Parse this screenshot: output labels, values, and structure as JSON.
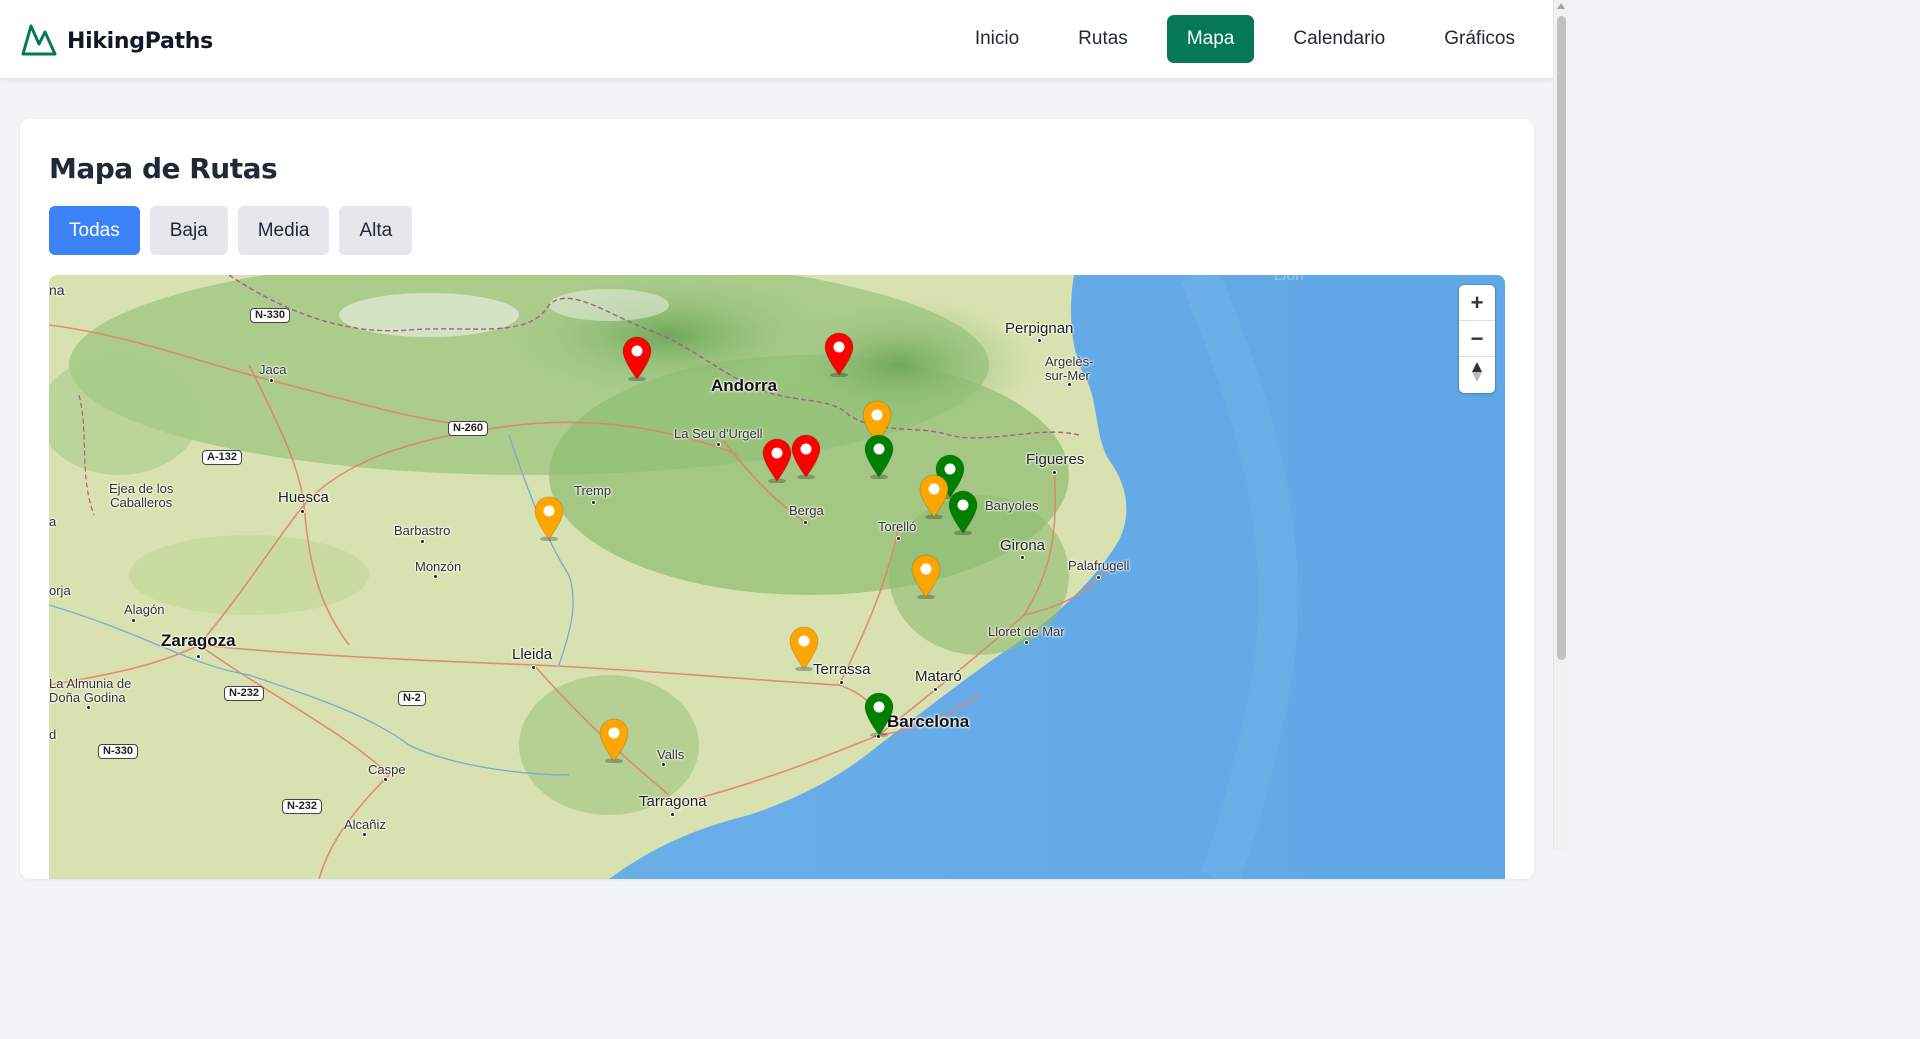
{
  "brand": {
    "name": "HikingPaths",
    "logo_icon": "mountain-icon",
    "color": "#047857"
  },
  "nav": {
    "items": [
      {
        "label": "Inicio",
        "active": false
      },
      {
        "label": "Rutas",
        "active": false
      },
      {
        "label": "Mapa",
        "active": true
      },
      {
        "label": "Calendario",
        "active": false
      },
      {
        "label": "Gráficos",
        "active": false
      }
    ]
  },
  "page": {
    "title": "Mapa de Rutas"
  },
  "filters": [
    {
      "label": "Todas",
      "active": true
    },
    {
      "label": "Baja",
      "active": false
    },
    {
      "label": "Media",
      "active": false
    },
    {
      "label": "Alta",
      "active": false
    }
  ],
  "map": {
    "controls": {
      "zoom_in": "+",
      "zoom_out": "−",
      "compass": "compass-icon"
    },
    "difficulty_colors": {
      "baja": "#008000",
      "media": "#ffa500",
      "alta": "#ff0000"
    },
    "places": {
      "perpignan": "Perpignan",
      "argeles": "Argelès-\nsur-Mer",
      "andorra": "Andorra",
      "jaca": "Jaca",
      "seu": "La Seu d'Urgell",
      "figueres": "Figueres",
      "ejea": "Ejea de los\nCaballeros",
      "huesca": "Huesca",
      "tremp": "Tremp",
      "banyoles": "Banyoles",
      "berga": "Berga",
      "torello": "Torelló",
      "girona": "Girona",
      "barbastro": "Barbastro",
      "monzon": "Monzón",
      "palafrugell": "Palafrugell",
      "alagon": "Alagón",
      "zaragoza": "Zaragoza",
      "lloret": "Lloret de Mar",
      "lleida": "Lleida",
      "terrassa": "Terrassa",
      "mataro": "Mataró",
      "almunia": "La Almunia de\nDoña Godina",
      "barcelona": "Barcelona",
      "valls": "Valls",
      "caspe": "Caspe",
      "tarragona": "Tarragona",
      "alcaniz": "Alcañiz",
      "lion": "Lion",
      "edge_na": "na",
      "edge_a": "a",
      "edge_orja": "orja",
      "edge_d": "d"
    },
    "roads": {
      "n330_top": "N-330",
      "n260": "N-260",
      "a132": "A-132",
      "n232_a": "N-232",
      "n2": "N-2",
      "n330_bottom": "N-330",
      "n232_b": "N-232"
    },
    "markers": [
      {
        "difficulty": "alta"
      },
      {
        "difficulty": "alta"
      },
      {
        "difficulty": "media"
      },
      {
        "difficulty": "alta"
      },
      {
        "difficulty": "alta"
      },
      {
        "difficulty": "baja"
      },
      {
        "difficulty": "baja"
      },
      {
        "difficulty": "media"
      },
      {
        "difficulty": "baja"
      },
      {
        "difficulty": "media"
      },
      {
        "difficulty": "media"
      },
      {
        "difficulty": "media"
      },
      {
        "difficulty": "baja"
      },
      {
        "difficulty": "media"
      }
    ]
  }
}
